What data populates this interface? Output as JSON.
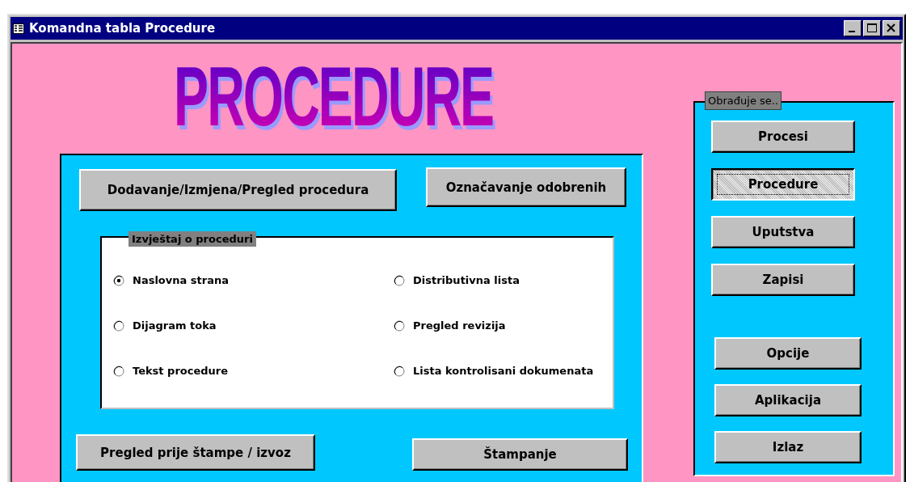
{
  "window": {
    "title": "Komandna tabla Procedure"
  },
  "logo": {
    "text": "PROCEDURE"
  },
  "main_buttons": [
    {
      "label": "Dodavanje/Izmjena/Pregled procedura"
    },
    {
      "label": "Označavanje odobrenih"
    }
  ],
  "report_group": {
    "title": "Izvještaj o proceduri",
    "options": [
      {
        "label": "Naslovna strana",
        "selected": true
      },
      {
        "label": "Distributivna lista",
        "selected": false
      },
      {
        "label": "Dijagram toka",
        "selected": false
      },
      {
        "label": "Pregled revizija",
        "selected": false
      },
      {
        "label": "Tekst procedure",
        "selected": false
      },
      {
        "label": "Lista kontrolisani dokumenata",
        "selected": false
      }
    ]
  },
  "bottom_buttons": [
    {
      "label": "Pregled prije štampe / izvoz"
    },
    {
      "label": "Štampanje"
    }
  ],
  "side_panel": {
    "title": "Obrađuje se..",
    "upper_buttons": [
      {
        "label": "Procesi",
        "selected": false
      },
      {
        "label": "Procedure",
        "selected": true
      },
      {
        "label": "Uputstva",
        "selected": false
      },
      {
        "label": "Zapisi",
        "selected": false
      }
    ],
    "lower_buttons": [
      {
        "label": "Opcije"
      },
      {
        "label": "Aplikacija"
      },
      {
        "label": "Izlaz"
      }
    ]
  }
}
